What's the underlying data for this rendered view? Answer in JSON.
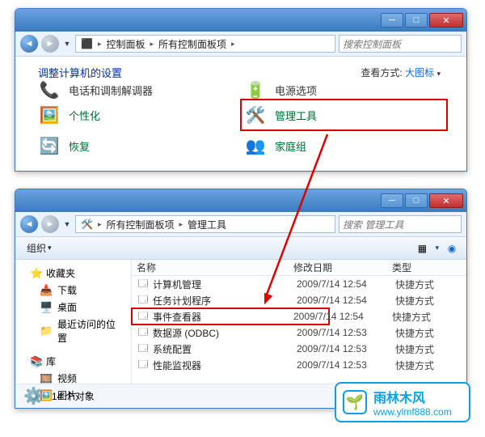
{
  "win1": {
    "path": {
      "seg1": "控制面板",
      "seg2": "所有控制面板项"
    },
    "search_placeholder": "搜索控制面板",
    "heading": "调整计算机的设置",
    "view_by_label": "查看方式:",
    "view_by_value": "大图标",
    "items": [
      {
        "label": "电话和调制解调器"
      },
      {
        "label": "电源选项"
      },
      {
        "label": "个性化"
      },
      {
        "label": "管理工具",
        "highlight": true
      },
      {
        "label": "恢复"
      },
      {
        "label": "家庭组"
      }
    ]
  },
  "win2": {
    "path": {
      "seg1": "所有控制面板项",
      "seg2": "管理工具"
    },
    "search_placeholder": "搜索 管理工具",
    "toolbar": {
      "organize": "组织"
    },
    "sidebar": {
      "favorites": {
        "head": "收藏夹",
        "items": [
          "下载",
          "桌面",
          "最近访问的位置"
        ]
      },
      "libraries": {
        "head": "库",
        "items": [
          "视频",
          "图片"
        ]
      }
    },
    "columns": {
      "name": "名称",
      "date": "修改日期",
      "type": "类型"
    },
    "rows": [
      {
        "name": "计算机管理",
        "date": "2009/7/14 12:54",
        "type": "快捷方式"
      },
      {
        "name": "任务计划程序",
        "date": "2009/7/14 12:54",
        "type": "快捷方式"
      },
      {
        "name": "事件查看器",
        "date": "2009/7/14 12:54",
        "type": "快捷方式",
        "highlight": true
      },
      {
        "name": "数据源 (ODBC)",
        "date": "2009/7/14 12:53",
        "type": "快捷方式"
      },
      {
        "name": "系统配置",
        "date": "2009/7/14 12:53",
        "type": "快捷方式"
      },
      {
        "name": "性能监视器",
        "date": "2009/7/14 12:53",
        "type": "快捷方式"
      }
    ],
    "status": "14 个对象"
  },
  "watermark": {
    "name": "雨林木风",
    "url": "www.ylmf888.com"
  }
}
